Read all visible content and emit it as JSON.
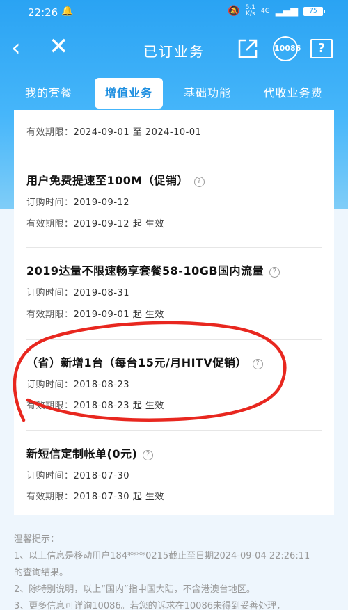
{
  "status_bar": {
    "time": "22:26",
    "speed_top": "5.1",
    "speed_unit": "K/s",
    "network": "4G",
    "battery": "75"
  },
  "nav": {
    "title": "已订业务",
    "hotline": "10086",
    "help": "?"
  },
  "tabs": [
    {
      "label": "我的套餐"
    },
    {
      "label": "增值业务"
    },
    {
      "label": "基础功能"
    },
    {
      "label": "代收业务费"
    }
  ],
  "items": [
    {
      "validity_label": "有效期限：",
      "validity_value": "2024-09-01 至 2024-10-01"
    },
    {
      "title": "用户免费提速至100M（促销）",
      "order_label": "订购时间：",
      "order_value": "2019-09-12",
      "validity_label": "有效期限：",
      "validity_value": "2019-09-12 起 生效"
    },
    {
      "title": "2019达量不限速畅享套餐58-10GB国内流量",
      "order_label": "订购时间：",
      "order_value": "2019-08-31",
      "validity_label": "有效期限：",
      "validity_value": "2019-09-01 起 生效"
    },
    {
      "title": "（省）新增1台（每台15元/月HITV促销）",
      "order_label": "订购时间：",
      "order_value": "2018-08-23",
      "validity_label": "有效期限：",
      "validity_value": "2018-08-23 起 生效"
    },
    {
      "title": "新短信定制帐单(0元)",
      "order_label": "订购时间：",
      "order_value": "2018-07-30",
      "validity_label": "有效期限：",
      "validity_value": "2018-07-30 起 生效"
    }
  ],
  "tips": {
    "heading": "温馨提示：",
    "line1": "1、以上信息是移动用户184****0215截止至日期2024-09-04 22:26:11",
    "line2": "的查询结果。",
    "line3": "2、除特别说明，以上“国内”指中国大陆，不含港澳台地区。",
    "line4": "3、更多信息可详询10086。若您的诉求在10086未得到妥善处理，"
  },
  "colors": {
    "header_blue": "#2aa3f3",
    "active_tab_text": "#1e8fe0",
    "annotation_red": "#e8271f"
  }
}
